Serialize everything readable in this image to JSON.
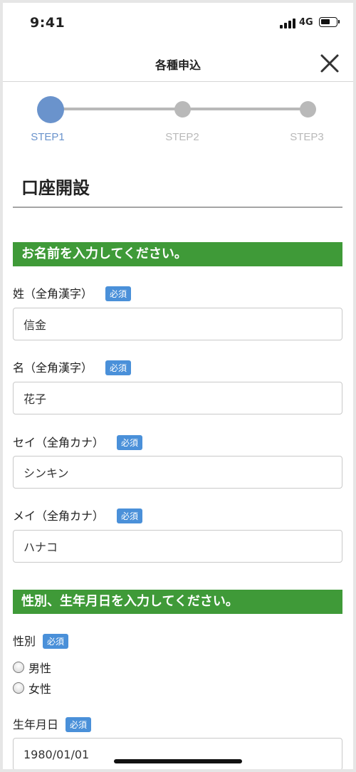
{
  "status_bar": {
    "time": "9:41",
    "network": "4G"
  },
  "header": {
    "title": "各種申込"
  },
  "stepper": {
    "active_color": "#6a93cc",
    "inactive_color": "#b9b9b9",
    "steps": [
      {
        "label": "STEP1",
        "state": "active"
      },
      {
        "label": "STEP2",
        "state": "inactive"
      },
      {
        "label": "STEP3",
        "state": "inactive"
      }
    ]
  },
  "page": {
    "title": "口座開設"
  },
  "section_name": {
    "heading": "お名前を入力してください。",
    "fields": [
      {
        "label": "姓（全角漢字）",
        "badge": "必須",
        "value": "信金"
      },
      {
        "label": "名（全角漢字）",
        "badge": "必須",
        "value": "花子"
      },
      {
        "label": "セイ（全角カナ）",
        "badge": "必須",
        "value": "シンキン"
      },
      {
        "label": "メイ（全角カナ）",
        "badge": "必須",
        "value": "ハナコ"
      }
    ]
  },
  "section_gender_birth": {
    "heading": "性別、生年月日を入力してください。",
    "gender": {
      "label": "性別",
      "badge": "必須",
      "options": [
        "男性",
        "女性"
      ]
    },
    "birthdate": {
      "label": "生年月日",
      "badge": "必須",
      "value": "1980/01/01"
    }
  },
  "colors": {
    "section_bar": "#3f9a38",
    "badge": "#4a90d9"
  }
}
